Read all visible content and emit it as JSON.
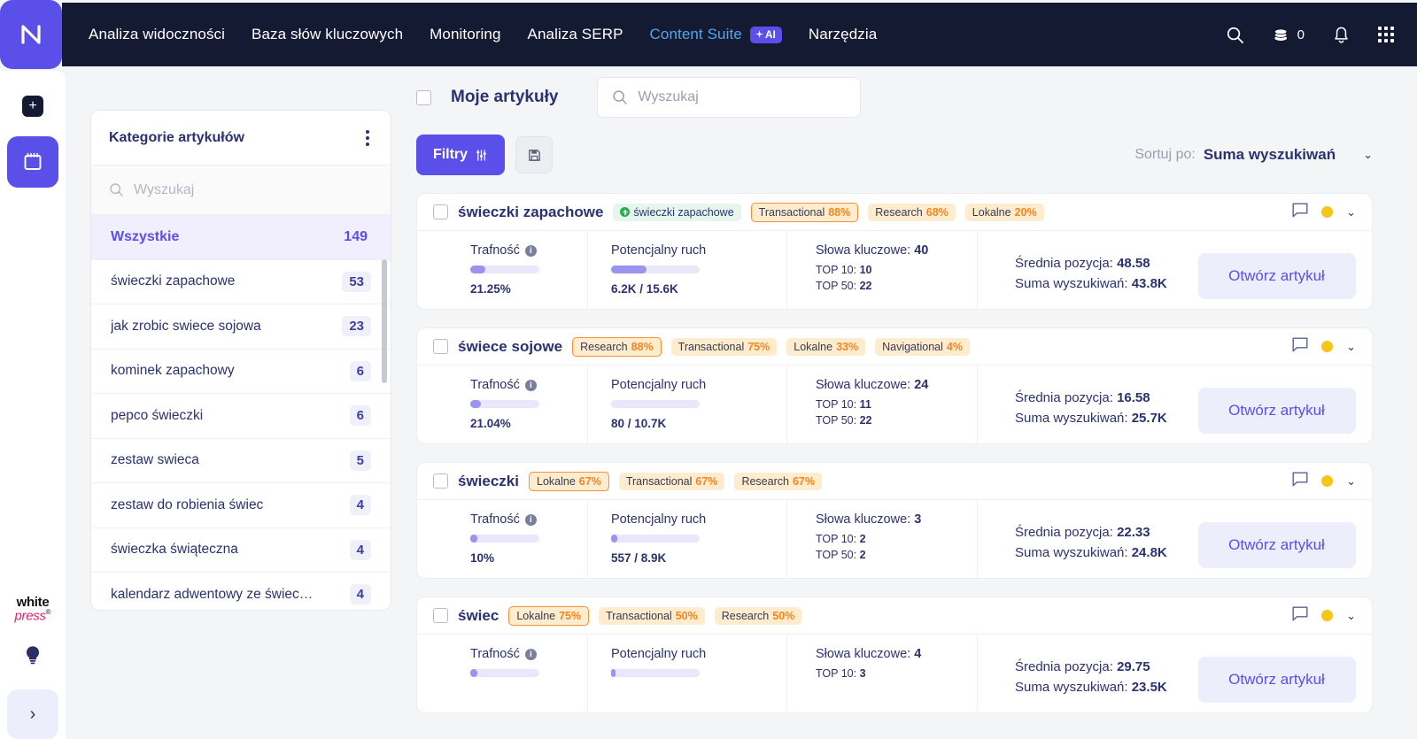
{
  "header": {
    "logo": "logo-n",
    "nav": [
      {
        "label": "Analiza widoczności",
        "active": false
      },
      {
        "label": "Baza słów kluczowych",
        "active": false
      },
      {
        "label": "Monitoring",
        "active": false
      },
      {
        "label": "Analiza SERP",
        "active": false
      },
      {
        "label": "Content Suite",
        "active": true,
        "badge": "AI"
      },
      {
        "label": "Narzędzia",
        "active": false
      }
    ],
    "icons": {
      "search": "search-icon",
      "coins": "coins-icon",
      "coins_count": "0",
      "bell": "bell-icon",
      "apps": "apps-grid-icon"
    }
  },
  "rail": {
    "add": "+",
    "tile_icon": "calendar-icon",
    "brand": {
      "line1": "white",
      "line2": "press",
      "mark": "®"
    },
    "bulb": "lightbulb-icon",
    "expand": "›"
  },
  "categories": {
    "title": "Kategorie artykułów",
    "menu_icon": "kebab-menu-icon",
    "search_placeholder": "Wyszukaj",
    "search_value": "",
    "items": [
      {
        "label": "Wszystkie",
        "count": "149",
        "selected": true
      },
      {
        "label": "świeczki zapachowe",
        "count": "53",
        "selected": false
      },
      {
        "label": "jak zrobic swiece sojowa",
        "count": "23",
        "selected": false
      },
      {
        "label": "kominek zapachowy",
        "count": "6",
        "selected": false
      },
      {
        "label": "pepco świeczki",
        "count": "6",
        "selected": false
      },
      {
        "label": "zestaw swieca",
        "count": "5",
        "selected": false
      },
      {
        "label": "zestaw do robienia świec",
        "count": "4",
        "selected": false
      },
      {
        "label": "świeczka świąteczna",
        "count": "4",
        "selected": false
      },
      {
        "label": "kalendarz adwentowy ze świec…",
        "count": "4",
        "selected": false
      }
    ]
  },
  "toolbar": {
    "my_articles_label": "Moje artykuły",
    "my_articles_checked": false,
    "search_placeholder": "Wyszukaj",
    "search_value": "",
    "filters_label": "Filtry",
    "filters_icon": "sliders-icon",
    "save_icon": "save-disk-icon",
    "sort_label": "Sortuj po:",
    "sort_value": "Suma wyszukiwań",
    "sort_chevron": "chevron-down-icon"
  },
  "labels": {
    "trafnosc": "Trafność",
    "potencjalny_ruch": "Potencjalny ruch",
    "slowa_kluczowe": "Słowa kluczowe:",
    "top10": "TOP 10:",
    "top50": "TOP 50:",
    "srednia_pozycja": "Średnia pozycja:",
    "suma_wyszukiwan": "Suma wyszukiwań:",
    "open_article": "Otwórz artykuł"
  },
  "cards": [
    {
      "title": "świeczki zapachowe",
      "checked": false,
      "tags": [
        {
          "text": "świeczki zapachowe",
          "pct": "",
          "style": "green",
          "icon": "plus-circle-icon"
        },
        {
          "text": "Transactional",
          "pct": "88%",
          "style": "amber-outlined"
        },
        {
          "text": "Research",
          "pct": "68%",
          "style": "amber"
        },
        {
          "text": "Lokalne",
          "pct": "20%",
          "style": "amber"
        }
      ],
      "trafnosc_pct": "21.25%",
      "trafnosc_bar": 21.25,
      "ruch_value": "6.2K / 15.6K",
      "ruch_bar": 40,
      "keywords": "40",
      "top10": "10",
      "top50": "22",
      "srednia_pozycja": "48.58",
      "suma_wyszukiwan": "43.8K",
      "comment_icon": "comment-icon",
      "status_color": "#f5c518"
    },
    {
      "title": "świece sojowe",
      "checked": false,
      "tags": [
        {
          "text": "Research",
          "pct": "88%",
          "style": "amber-outlined"
        },
        {
          "text": "Transactional",
          "pct": "75%",
          "style": "amber"
        },
        {
          "text": "Lokalne",
          "pct": "33%",
          "style": "amber"
        },
        {
          "text": "Navigational",
          "pct": "4%",
          "style": "amber"
        }
      ],
      "trafnosc_pct": "21.04%",
      "trafnosc_bar": 16,
      "ruch_value": "80 / 10.7K",
      "ruch_bar": 0,
      "keywords": "24",
      "top10": "11",
      "top50": "22",
      "srednia_pozycja": "16.58",
      "suma_wyszukiwan": "25.7K",
      "comment_icon": "comment-icon",
      "status_color": "#f5c518"
    },
    {
      "title": "świeczki",
      "checked": false,
      "tags": [
        {
          "text": "Lokalne",
          "pct": "67%",
          "style": "amber-outlined"
        },
        {
          "text": "Transactional",
          "pct": "67%",
          "style": "amber"
        },
        {
          "text": "Research",
          "pct": "67%",
          "style": "amber"
        }
      ],
      "trafnosc_pct": "10%",
      "trafnosc_bar": 10,
      "ruch_value": "557 / 8.9K",
      "ruch_bar": 7,
      "keywords": "3",
      "top10": "2",
      "top50": "2",
      "srednia_pozycja": "22.33",
      "suma_wyszukiwan": "24.8K",
      "comment_icon": "comment-icon",
      "status_color": "#f5c518"
    },
    {
      "title": "świec",
      "checked": false,
      "tags": [
        {
          "text": "Lokalne",
          "pct": "75%",
          "style": "amber-outlined"
        },
        {
          "text": "Transactional",
          "pct": "50%",
          "style": "amber"
        },
        {
          "text": "Research",
          "pct": "50%",
          "style": "amber"
        }
      ],
      "trafnosc_pct": "",
      "trafnosc_bar": 10,
      "ruch_value": "",
      "ruch_bar": 5,
      "keywords": "4",
      "top10": "3",
      "top50": "",
      "srednia_pozycja": "29.75",
      "suma_wyszukiwan": "23.5K",
      "comment_icon": "comment-icon",
      "status_color": "#f5c518"
    }
  ]
}
